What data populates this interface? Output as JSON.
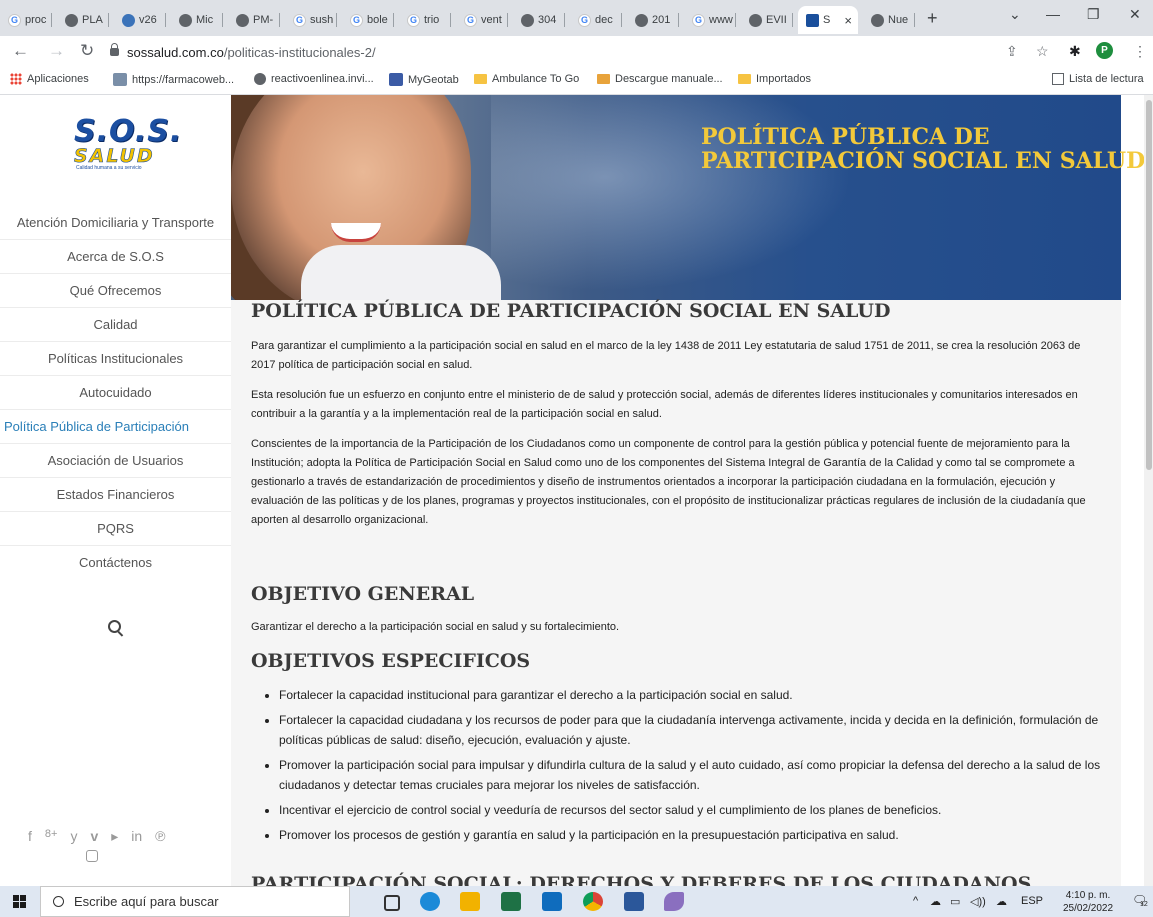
{
  "browser": {
    "tabs": [
      {
        "label": "proc",
        "fav": "g"
      },
      {
        "label": "PLA",
        "fav": "c"
      },
      {
        "label": "v26",
        "fav": "b"
      },
      {
        "label": "Mic",
        "fav": "c"
      },
      {
        "label": "PM-",
        "fav": "c"
      },
      {
        "label": "sush",
        "fav": "g"
      },
      {
        "label": "bole",
        "fav": "g"
      },
      {
        "label": "trio",
        "fav": "g"
      },
      {
        "label": "vent",
        "fav": "g"
      },
      {
        "label": "304",
        "fav": "c"
      },
      {
        "label": "dec",
        "fav": "g"
      },
      {
        "label": "201",
        "fav": "c"
      },
      {
        "label": "www",
        "fav": "g"
      },
      {
        "label": "EVII",
        "fav": "c"
      },
      {
        "label": "S",
        "fav": "s",
        "active": true
      },
      {
        "label": "Nue",
        "fav": "c"
      }
    ],
    "new_tab_label": "+",
    "address": {
      "domain": "sossalud.com.co",
      "path": "/politicas-institucionales-2/"
    },
    "profile_initial": "P",
    "bookmarks": [
      {
        "label": "Aplicaciones",
        "icon": "apps-grid-icon"
      },
      {
        "label": "https://farmacoweb...",
        "icon": "site-icon"
      },
      {
        "label": "reactivoenlinea.invi...",
        "icon": "globe-icon"
      },
      {
        "label": "MyGeotab",
        "icon": "mygeotab-icon"
      },
      {
        "label": "Ambulance To Go",
        "icon": "folder-icon"
      },
      {
        "label": "Descargue manuale...",
        "icon": "folder-icon"
      },
      {
        "label": "Importados",
        "icon": "folder-icon"
      }
    ],
    "reading_list_label": "Lista de lectura"
  },
  "site": {
    "logo": {
      "line1": "S.O.S.",
      "line2": "SALUD",
      "tagline": "Calidad humana a su servicio"
    },
    "menu": [
      "Atención Domiciliaria y Transporte",
      "Acerca de S.O.S",
      "Qué Ofrecemos",
      "Calidad",
      "Políticas Institucionales",
      "Autocuidado",
      "Política Pública de Participación",
      "Asociación de Usuarios",
      "Estados Financieros",
      "PQRS",
      "Contáctenos"
    ],
    "active_menu_index": 6,
    "social": [
      "f",
      "8+",
      "y",
      "v",
      "▸",
      "in",
      "℗"
    ]
  },
  "hero": {
    "title_line1": "POLÍTICA PÚBLICA DE",
    "title_line2": "PARTICIPACIÓN SOCIAL EN SALUD"
  },
  "content": {
    "page_title": "POLÍTICA PÚBLICA DE PARTICIPACIÓN SOCIAL EN SALUD",
    "para1": "Para garantizar el cumplimiento a la participación social en salud en el marco de la ley 1438 de 2011 Ley estatutaria de salud 1751 de 2011, se crea la resolución 2063 de 2017 política de participación social en salud.",
    "para2": "Esta resolución fue un esfuerzo en conjunto entre el ministerio de de salud y protección social, además de diferentes líderes institucionales y comunitarios interesados en contribuir a la garantía y a la implementación real de la participación social en salud.",
    "para3": "Conscientes de la importancia de la Participación de los Ciudadanos como un componente de control para la gestión pública y potencial fuente de mejoramiento para la Institución; adopta la Política de Participación Social en Salud  como uno de los componentes del Sistema Integral de Garantía de la Calidad y como tal se compromete a gestionarlo a través de estandarización de procedimientos y diseño de instrumentos orientados a incorporar la participación ciudadana en la formulación, ejecución y evaluación de las políticas y de los planes, programas y proyectos institucionales, con el propósito de institucionalizar prácticas regulares de inclusión de la ciudadanía que aporten al desarrollo organizacional.",
    "heading_general": "OBJETIVO GENERAL",
    "general_text": "Garantizar el derecho a la participación social en salud y su fortalecimiento.",
    "heading_specific": "OBJETIVOS ESPECIFICOS",
    "objectives": [
      "Fortalecer la capacidad institucional para garantizar el derecho a la participación social en salud.",
      "Fortalecer la capacidad ciudadana y los recursos de poder para que la ciudadanía intervenga activamente, incida y decida en la definición, formulación de políticas públicas de salud: diseño, ejecución, evaluación y ajuste.",
      "Promover la participación social para impulsar y difundirla cultura de la salud y el auto cuidado, así como propiciar la defensa del derecho a la salud de los ciudadanos y detectar temas cruciales para mejorar los niveles de satisfacción.",
      "Incentivar el ejercicio de control social y veeduría de recursos del sector salud y el cumplimiento de los planes de beneficios.",
      "Promover los procesos de gestión y garantía en salud y la participación en la presupuestación participativa en salud."
    ],
    "heading_next": "PARTICIPACIÓN SOCIAL: DERECHOS Y DEBERES DE LOS CIUDADANOS"
  },
  "taskbar": {
    "search_placeholder": "Escribe aquí para buscar",
    "language": "ESP",
    "time": "4:10 p. m.",
    "date": "25/02/2022",
    "notifications": "12"
  }
}
